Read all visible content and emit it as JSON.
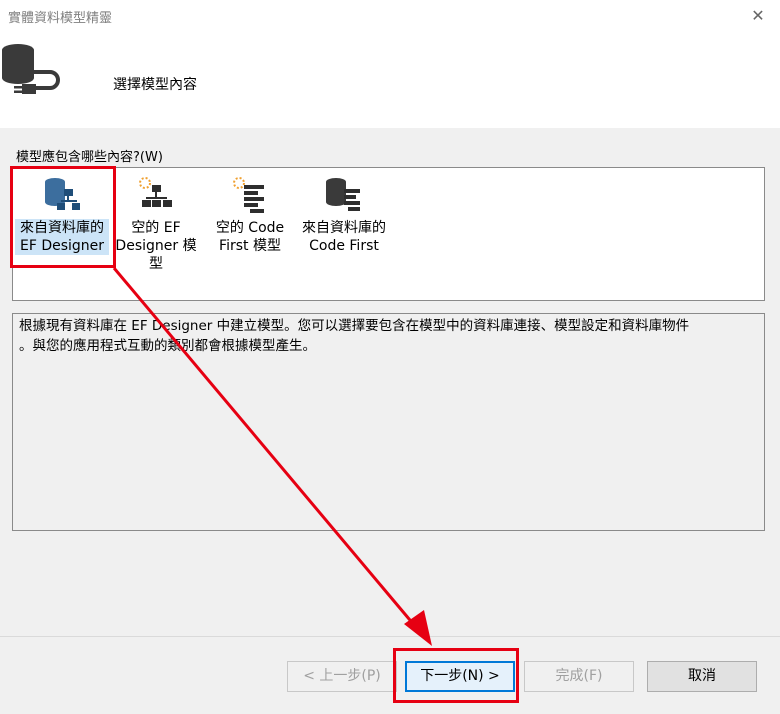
{
  "window": {
    "title": "實體資料模型精靈",
    "close_glyph": "✕"
  },
  "header": {
    "title": "選擇模型內容"
  },
  "content_label": "模型應包含哪些內容?(W)",
  "items": [
    {
      "line1": "來自資料庫的",
      "line2": "EF Designer",
      "line3": "",
      "icon": "database-model-icon",
      "selected": true
    },
    {
      "line1": "空的 EF",
      "line2": "Designer 模",
      "line3": "型",
      "icon": "empty-designer-icon",
      "selected": false
    },
    {
      "line1": "空的 Code",
      "line2": "First 模型",
      "line3": "",
      "icon": "empty-code-first-icon",
      "selected": false
    },
    {
      "line1": "來自資料庫的",
      "line2": "Code First",
      "line3": "",
      "icon": "database-code-first-icon",
      "selected": false
    }
  ],
  "description": {
    "line1": "根據現有資料庫在 EF Designer 中建立模型。您可以選擇要包含在模型中的資料庫連接、模型設定和資料庫物件",
    "line2": "。與您的應用程式互動的類別都會根據模型產生。"
  },
  "buttons": {
    "back": "< 上一步(P)",
    "next": "下一步(N) >",
    "finish": "完成(F)",
    "cancel": "取消"
  },
  "colors": {
    "annotation": "#e60012",
    "selection": "#cce4f7",
    "primary_border": "#0078d7"
  }
}
